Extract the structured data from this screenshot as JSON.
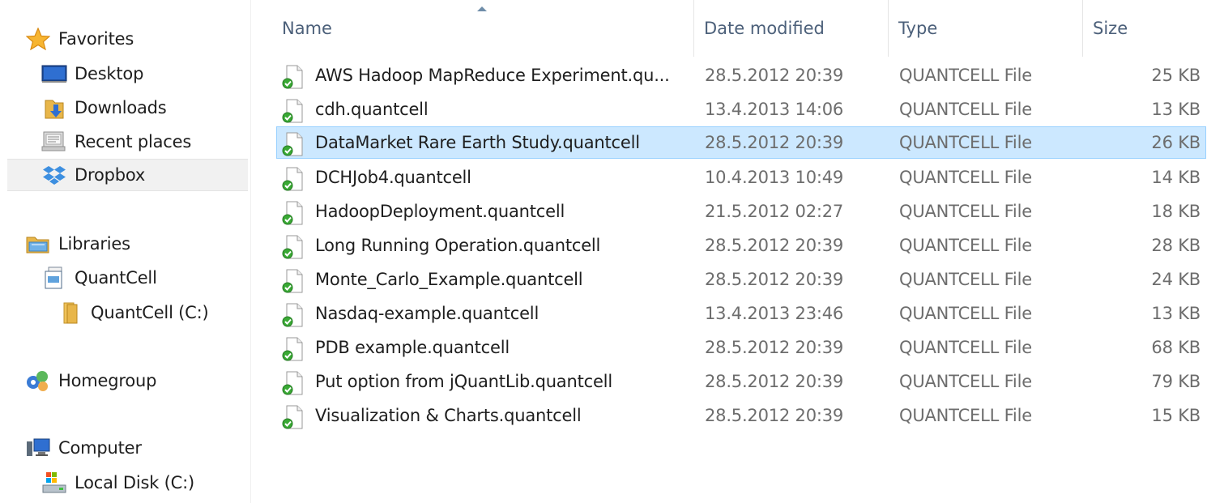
{
  "navigation": {
    "favorites": {
      "label": "Favorites",
      "icon": "star-icon",
      "items": [
        {
          "label": "Desktop",
          "icon": "desktop-icon"
        },
        {
          "label": "Downloads",
          "icon": "downloads-icon"
        },
        {
          "label": "Recent places",
          "icon": "recent-places-icon"
        },
        {
          "label": "Dropbox",
          "icon": "dropbox-icon",
          "selected": true
        }
      ]
    },
    "libraries": {
      "label": "Libraries",
      "icon": "libraries-icon",
      "items": [
        {
          "label": "QuantCell",
          "icon": "library-icon"
        },
        {
          "label": "QuantCell (C:)",
          "icon": "folder-icon"
        }
      ]
    },
    "homegroup": {
      "label": "Homegroup",
      "icon": "homegroup-icon"
    },
    "computer": {
      "label": "Computer",
      "icon": "computer-icon",
      "items": [
        {
          "label": "Local Disk (C:)",
          "icon": "local-disk-icon"
        }
      ]
    }
  },
  "file_list": {
    "columns": {
      "name": "Name",
      "date": "Date modified",
      "type": "Type",
      "size": "Size"
    },
    "sort_column": "name",
    "sort_direction": "ascending",
    "rows": [
      {
        "name": "AWS Hadoop MapReduce Experiment.qu...",
        "date": "28.5.2012 20:39",
        "type": "QUANTCELL File",
        "size": "25 KB"
      },
      {
        "name": "cdh.quantcell",
        "date": "13.4.2013 14:06",
        "type": "QUANTCELL File",
        "size": "13 KB"
      },
      {
        "name": "DataMarket Rare Earth Study.quantcell",
        "date": "28.5.2012 20:39",
        "type": "QUANTCELL File",
        "size": "26 KB",
        "selected": true
      },
      {
        "name": "DCHJob4.quantcell",
        "date": "10.4.2013 10:49",
        "type": "QUANTCELL File",
        "size": "14 KB"
      },
      {
        "name": "HadoopDeployment.quantcell",
        "date": "21.5.2012 02:27",
        "type": "QUANTCELL File",
        "size": "18 KB"
      },
      {
        "name": "Long Running Operation.quantcell",
        "date": "28.5.2012 20:39",
        "type": "QUANTCELL File",
        "size": "28 KB"
      },
      {
        "name": "Monte_Carlo_Example.quantcell",
        "date": "28.5.2012 20:39",
        "type": "QUANTCELL File",
        "size": "24 KB"
      },
      {
        "name": "Nasdaq-example.quantcell",
        "date": "13.4.2013 23:46",
        "type": "QUANTCELL File",
        "size": "13 KB"
      },
      {
        "name": "PDB example.quantcell",
        "date": "28.5.2012 20:39",
        "type": "QUANTCELL File",
        "size": "68 KB"
      },
      {
        "name": "Put option from jQuantLib.quantcell",
        "date": "28.5.2012 20:39",
        "type": "QUANTCELL File",
        "size": "79 KB"
      },
      {
        "name": "Visualization & Charts.quantcell",
        "date": "28.5.2012 20:39",
        "type": "QUANTCELL File",
        "size": "15 KB"
      }
    ],
    "file_icon": "quantcell-file-icon"
  },
  "colors": {
    "selection_fill": "#cce8ff",
    "selection_border": "#99d1ff",
    "header_text": "#4c607a",
    "secondary_text": "#6d6d6d"
  }
}
